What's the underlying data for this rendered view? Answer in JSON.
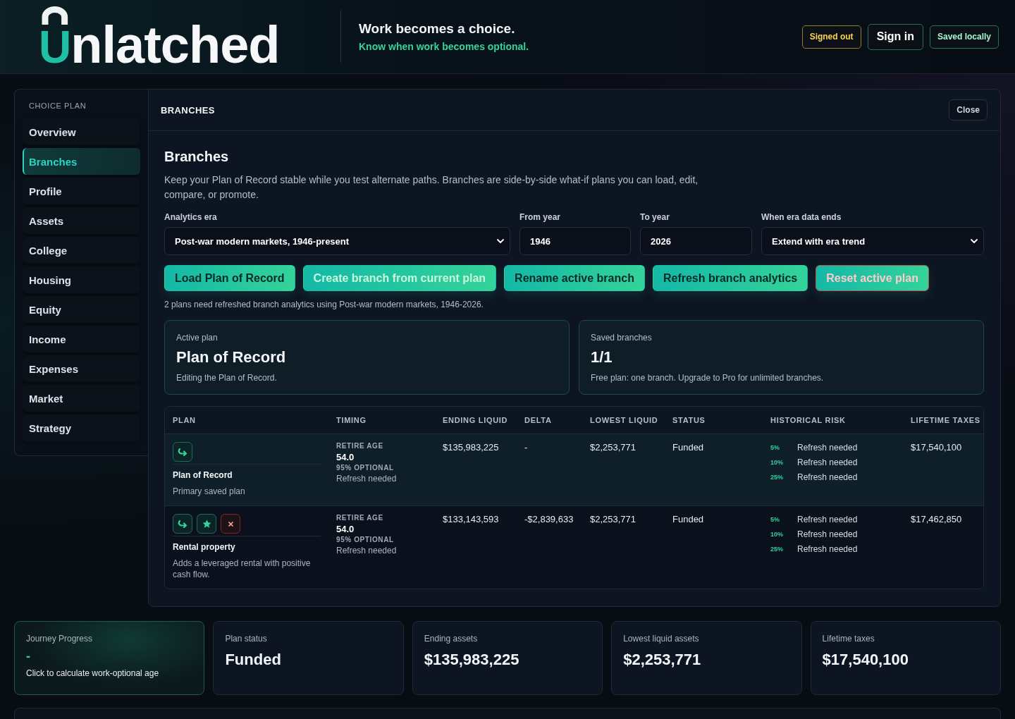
{
  "header": {
    "logo": "Unlatched",
    "tagline": "Work becomes a choice.",
    "subtagline": "Know when work becomes optional.",
    "badges": [
      {
        "label": "Signed out",
        "kind": "warning"
      },
      {
        "label": "Sign in",
        "kind": "primary"
      },
      {
        "label": "Saved locally",
        "kind": "success"
      }
    ]
  },
  "sidebar": {
    "heading": "CHOICE PLAN",
    "items": [
      {
        "label": "Overview",
        "selected": false
      },
      {
        "label": "Branches",
        "selected": true
      },
      {
        "label": "Profile",
        "selected": false
      },
      {
        "label": "Assets",
        "selected": false
      },
      {
        "label": "College",
        "selected": false
      },
      {
        "label": "Housing",
        "selected": false
      },
      {
        "label": "Equity",
        "selected": false
      },
      {
        "label": "Income",
        "selected": false
      },
      {
        "label": "Expenses",
        "selected": false
      },
      {
        "label": "Market",
        "selected": false
      },
      {
        "label": "Strategy",
        "selected": false
      }
    ]
  },
  "panel": {
    "title": "BRANCHES",
    "close_label": "Close",
    "heading": "Branches",
    "description": "Keep your Plan of Record stable while you test alternate paths. Branches are side-by-side what-if plans you can load, edit, compare, or promote.",
    "fields": [
      {
        "kind": "select",
        "label": "Analytics era",
        "value": "Post-war modern markets, 1946-present"
      },
      {
        "kind": "input",
        "label": "From year",
        "value": "1946"
      },
      {
        "kind": "input",
        "label": "To year",
        "value": "2026"
      },
      {
        "kind": "select",
        "label": "When era data ends",
        "value": "Extend with era trend"
      }
    ],
    "actions": [
      {
        "label": "Load Plan of Record",
        "kind": "primary"
      },
      {
        "label": "Create branch from current plan",
        "kind": "highlight"
      },
      {
        "label": "Rename active branch",
        "kind": "primary"
      },
      {
        "label": "Refresh branch analytics",
        "kind": "primary"
      },
      {
        "label": "Reset active plan",
        "kind": "danger"
      }
    ],
    "note": "2 plans need refreshed branch analytics using Post-war modern markets, 1946-2026.",
    "summary_cards": [
      {
        "label": "Active plan",
        "value": "Plan of Record",
        "caption": "Editing the Plan of Record."
      },
      {
        "label": "Saved branches",
        "value": "1/1",
        "caption": "Free plan: one branch. Upgrade to Pro for unlimited branches."
      }
    ],
    "table": {
      "columns": [
        "PLAN",
        "TIMING",
        "ENDING LIQUID",
        "DELTA",
        "LOWEST LIQUID",
        "STATUS",
        "HISTORICAL RISK",
        "LIFETIME TAXES"
      ],
      "rows": [
        {
          "selected": true,
          "actions": [
            {
              "kind": "load"
            }
          ],
          "name": "Plan of Record",
          "description": "Primary saved plan",
          "timing": {
            "label": "RETIRE AGE",
            "age": "54.0",
            "confidence": "95% OPTIONAL",
            "status": "Refresh needed"
          },
          "ending_liquid": "$135,983,225",
          "delta": "-",
          "lowest_liquid": "$2,253,771",
          "status": "Funded",
          "historical_risk": [
            {
              "percentile": "5%",
              "value": "Refresh needed"
            },
            {
              "percentile": "10%",
              "value": "Refresh needed"
            },
            {
              "percentile": "25%",
              "value": "Refresh needed"
            }
          ],
          "lifetime_taxes": "$17,540,100"
        },
        {
          "selected": false,
          "actions": [
            {
              "kind": "load"
            },
            {
              "kind": "promote"
            },
            {
              "kind": "delete"
            }
          ],
          "name": "Rental property",
          "description": "Adds a leveraged rental with positive cash flow.",
          "timing": {
            "label": "RETIRE AGE",
            "age": "54.0",
            "confidence": "95% OPTIONAL",
            "status": "Refresh needed"
          },
          "ending_liquid": "$133,143,593",
          "delta": "-$2,839,633",
          "lowest_liquid": "$2,253,771",
          "status": "Funded",
          "historical_risk": [
            {
              "percentile": "5%",
              "value": "Refresh needed"
            },
            {
              "percentile": "10%",
              "value": "Refresh needed"
            },
            {
              "percentile": "25%",
              "value": "Refresh needed"
            }
          ],
          "lifetime_taxes": "$17,462,850"
        }
      ]
    }
  },
  "stats": [
    {
      "kind": "journey",
      "label": "Journey Progress",
      "value": "-",
      "caption": "Click to calculate work-optional age"
    },
    {
      "kind": "metric",
      "label": "Plan status",
      "value": "Funded"
    },
    {
      "kind": "metric",
      "label": "Ending assets",
      "value": "$135,983,225"
    },
    {
      "kind": "metric",
      "label": "Lowest liquid assets",
      "value": "$2,253,771"
    },
    {
      "kind": "metric",
      "label": "Lifetime taxes",
      "value": "$17,540,100"
    }
  ]
}
